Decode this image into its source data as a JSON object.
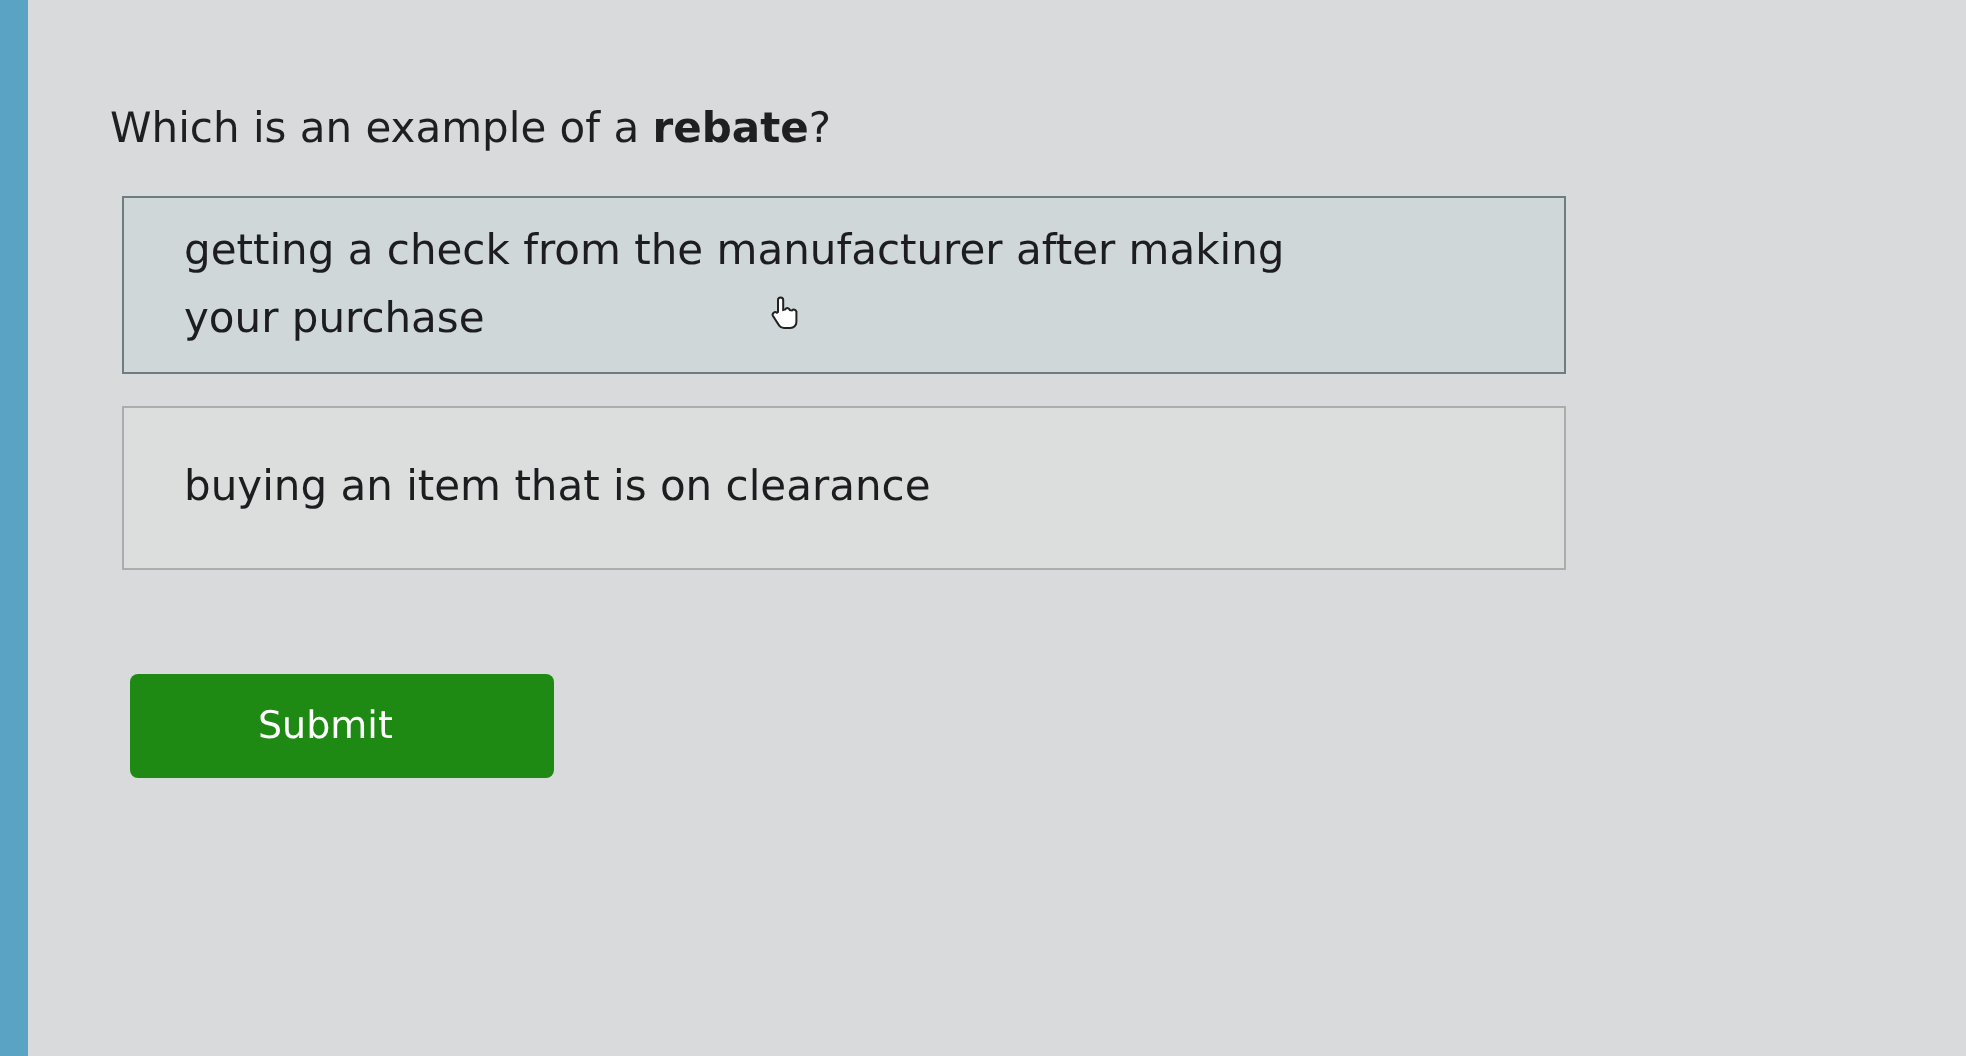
{
  "question": "Which is an example of a **rebate**?",
  "options": [
    {
      "label": "getting a check from the manufacturer after making your purchase",
      "selected": true
    },
    {
      "label": "buying an item that is on clearance",
      "selected": false
    }
  ],
  "submit": {
    "label": "Submit"
  }
}
